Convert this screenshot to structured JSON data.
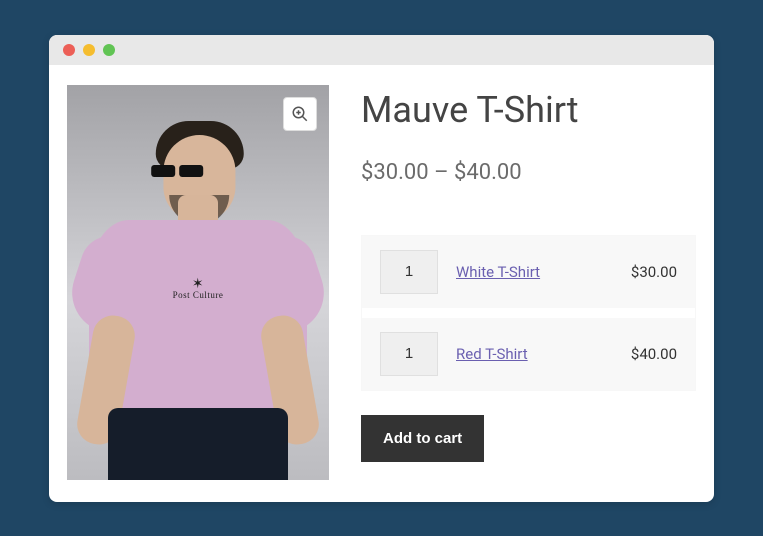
{
  "product": {
    "title": "Mauve T-Shirt",
    "price_range": "$30.00 – $40.00",
    "print_text": "Post Culture"
  },
  "bundle": [
    {
      "qty": "1",
      "name": "White T-Shirt",
      "price": "$30.00"
    },
    {
      "qty": "1",
      "name": "Red T-Shirt",
      "price": "$40.00"
    }
  ],
  "buttons": {
    "add_to_cart": "Add to cart"
  }
}
